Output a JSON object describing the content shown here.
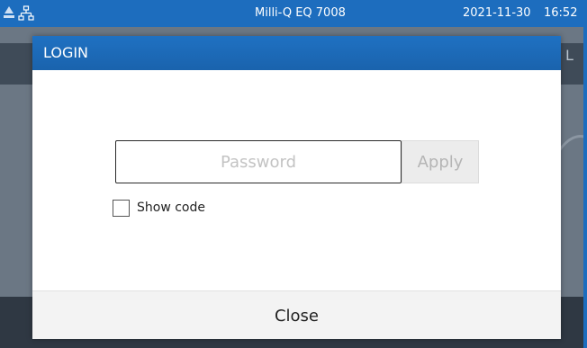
{
  "status_bar": {
    "device_name": "Milli-Q EQ 7008",
    "date": "2021-11-30",
    "time": "16:52",
    "left_icons": [
      "water-drop-icon",
      "network-icon"
    ]
  },
  "background": {
    "ghost_text": "L"
  },
  "dialog": {
    "title": "LOGIN",
    "password_placeholder": "Password",
    "password_value": "",
    "apply_label": "Apply",
    "show_code_label": "Show code",
    "show_code_checked": false,
    "close_label": "Close"
  },
  "colors": {
    "accent": "#1d6dbe",
    "header": "#1f71c2",
    "apply_disabled_bg": "#ececec",
    "apply_disabled_text": "#b5b5b5"
  }
}
